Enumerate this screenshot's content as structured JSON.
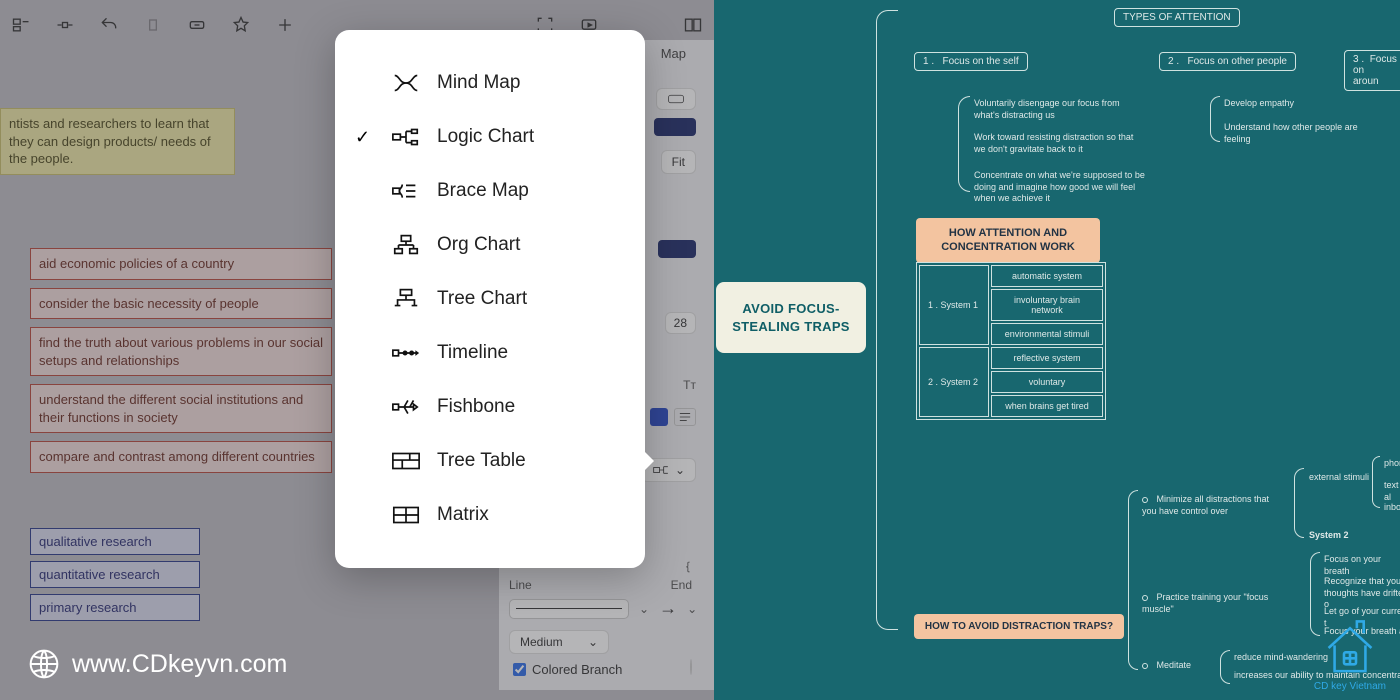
{
  "left_panel": {
    "yellow_note": "ntists and researchers to learn that they can design products/ needs of the people.",
    "red_items": [
      "aid economic policies of a country",
      "consider the basic necessity of people",
      "find the truth about various problems in our social setups and relationships",
      "understand the different social institutions and their functions in society",
      "compare and contrast among different countries"
    ],
    "blue_items": [
      "qualitative research",
      "quantitative research",
      "primary research"
    ],
    "watermark": "www.CDkeyvn.com"
  },
  "popup": {
    "items": [
      {
        "label": "Mind Map",
        "selected": false
      },
      {
        "label": "Logic Chart",
        "selected": true
      },
      {
        "label": "Brace Map",
        "selected": false
      },
      {
        "label": "Org Chart",
        "selected": false
      },
      {
        "label": "Tree Chart",
        "selected": false
      },
      {
        "label": "Timeline",
        "selected": false
      },
      {
        "label": "Fishbone",
        "selected": false
      },
      {
        "label": "Tree Table",
        "selected": false,
        "arrow": true
      },
      {
        "label": "Matrix",
        "selected": false
      }
    ]
  },
  "right_sidebar": {
    "tab": "Map",
    "fit": "Fit",
    "font_size": "28",
    "tt_label": "Tᴛ",
    "line_label": "Line",
    "end_label": "End",
    "weight": "Medium",
    "colored_branch": "Colored Branch"
  },
  "teal": {
    "main": "AVOID FOCUS-STEALING TRAPS",
    "top_title": "TYPES OF ATTENTION",
    "types": [
      {
        "num": "1 .",
        "label": "Focus on the self"
      },
      {
        "num": "2 .",
        "label": "Focus on other people"
      },
      {
        "num": "3 .",
        "label": "Focus on\\naroun"
      }
    ],
    "type1_sub": [
      "Voluntarily disengage our focus from what's distracting us",
      "Work toward resisting distraction so that we don't gravitate back to it",
      "Concentrate on what we're supposed to be doing and imagine how good we will feel when we achieve it"
    ],
    "type2_sub": [
      "Develop empathy",
      "Understand how other people are feeling"
    ],
    "table_title": "HOW ATTENTION AND CONCENTRATION WORK",
    "table_rows": [
      {
        "sys": "1 .  System 1",
        "cells": [
          "automatic system",
          "involuntary brain network",
          "environmental stimuli"
        ]
      },
      {
        "sys": "2 .  System 2",
        "cells": [
          "reflective system",
          "voluntary",
          "when brains get tired"
        ]
      }
    ],
    "bottom_title": "HOW TO AVOID DISTRACTION TRAPS?",
    "bottom_items": [
      {
        "t": "Minimize all distractions that you have control over",
        "sub": [
          "external stimuli",
          "System 2"
        ],
        "sub2": [
          "phone",
          "text al",
          "inbox"
        ]
      },
      {
        "t": "Practice training your \"focus muscle\"",
        "sub": [
          "Focus on your breath",
          "Recognize that your thoughts have drifted o",
          "Let go of your current t",
          "Focus    your breath ag"
        ]
      },
      {
        "t": "Meditate",
        "sub": [
          "reduce mind-wandering",
          "increases our ability to maintain concentration"
        ]
      }
    ],
    "logo_caption": "CD key Vietnam"
  }
}
